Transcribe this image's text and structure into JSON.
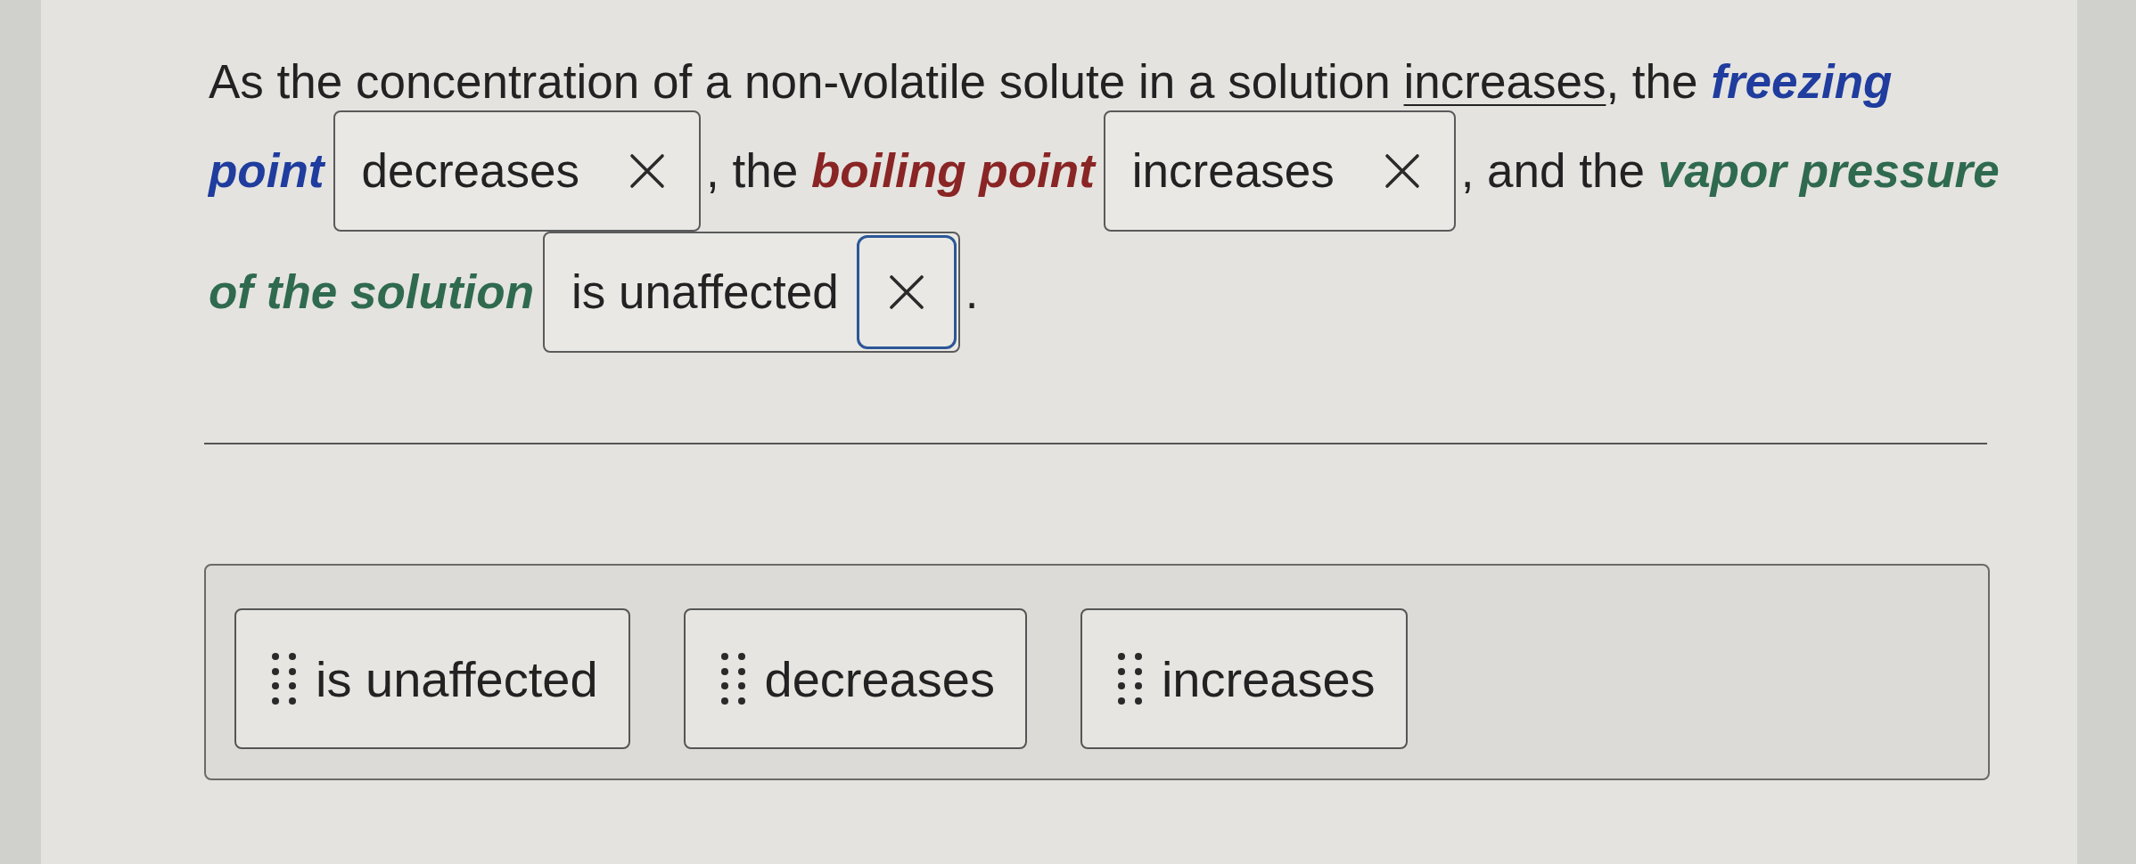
{
  "question": {
    "lines": [
      {
        "segments": [
          {
            "kind": "text",
            "parts": [
              {
                "kind": "plain",
                "text": "As the concentration of a non-volatile solute in a solution "
              },
              {
                "kind": "underlined",
                "text": "increases"
              },
              {
                "kind": "plain",
                "text": ", the "
              },
              {
                "kind": "term",
                "text": "freezing",
                "color": "#1f3c9e"
              }
            ]
          }
        ]
      },
      {
        "segments": [
          {
            "kind": "text",
            "parts": [
              {
                "kind": "term",
                "text": "point",
                "color": "#1f3c9e"
              }
            ]
          },
          {
            "kind": "blank",
            "answer": "decreases",
            "focused": false
          },
          {
            "kind": "text",
            "parts": [
              {
                "kind": "plain",
                "text": ", the "
              },
              {
                "kind": "term",
                "text": "boiling point",
                "color": "#8a2525"
              }
            ]
          },
          {
            "kind": "blank",
            "answer": "increases",
            "focused": false
          },
          {
            "kind": "text",
            "parts": [
              {
                "kind": "plain",
                "text": ", and the "
              },
              {
                "kind": "term",
                "text": "vapor pressure",
                "color": "#2f6a4f"
              }
            ]
          }
        ]
      },
      {
        "segments": [
          {
            "kind": "text",
            "parts": [
              {
                "kind": "term",
                "text": "of the solution",
                "color": "#2f6a4f"
              }
            ]
          },
          {
            "kind": "blank",
            "answer": "is unaffected",
            "focused": true
          },
          {
            "kind": "text",
            "parts": [
              {
                "kind": "plain",
                "text": "."
              }
            ]
          }
        ]
      }
    ]
  },
  "choices": [
    {
      "label": "is unaffected"
    },
    {
      "label": "decreases"
    },
    {
      "label": "increases"
    }
  ]
}
